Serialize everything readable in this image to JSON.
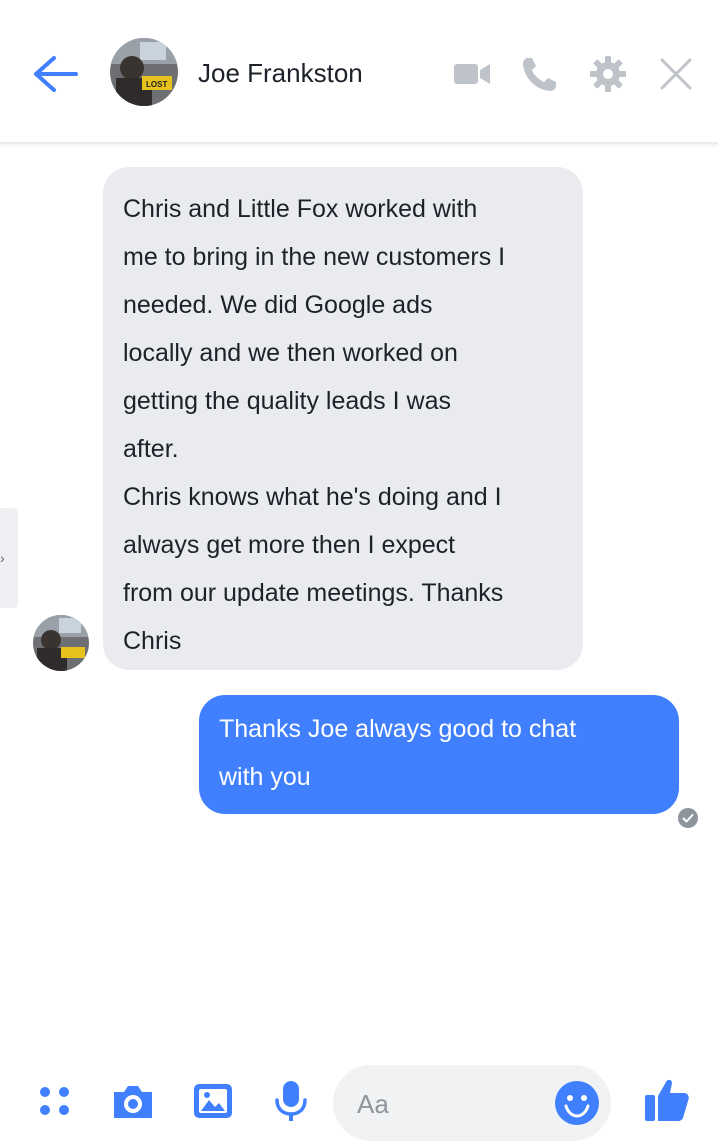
{
  "header": {
    "contact_name": "Joe Frankston",
    "icons": [
      "back-arrow-icon",
      "video-camera-icon",
      "phone-icon",
      "gear-icon",
      "close-icon"
    ],
    "avatar_sign_text": "LOST",
    "accent_color": "#4080ff",
    "inactive_icon_color": "#bec2c9"
  },
  "messages": [
    {
      "direction": "incoming",
      "lines": [
        "Chris and Little Fox worked with",
        "me to bring in the new customers I",
        "needed. We did Google ads",
        "locally and we then worked on",
        "getting the quality leads I was",
        "after.",
        "Chris knows what he's doing and I",
        "always get more then I expect",
        "from our update meetings. Thanks",
        "Chris"
      ],
      "bubble_color": "#e9ebee"
    },
    {
      "direction": "outgoing",
      "lines": [
        "Thanks Joe always good to chat",
        "with you"
      ],
      "bubble_color": "#4080ff",
      "status": "seen"
    }
  ],
  "side_tab": {
    "glyph": "›"
  },
  "composer": {
    "placeholder": "Aa",
    "icons": [
      "apps-grid-icon",
      "camera-icon",
      "photo-icon",
      "microphone-icon",
      "emoji-icon",
      "thumbs-up-icon"
    ]
  }
}
